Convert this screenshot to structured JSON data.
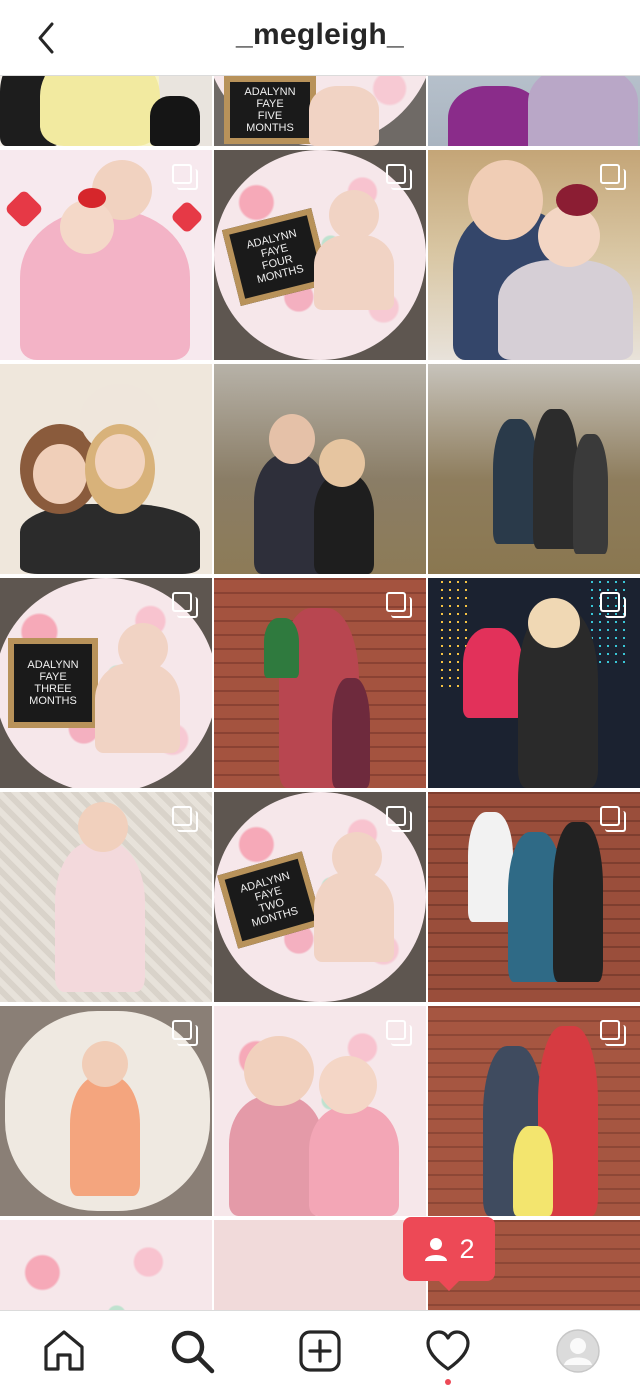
{
  "header": {
    "username": "_megleigh_",
    "back_icon": "chevron-left-icon"
  },
  "grid": {
    "signs": {
      "five_months": "ADALYNN\nFAYE\nFIVE\nMONTHS",
      "four_months": "ADALYNN\nFAYE\nFOUR\nMONTHS",
      "three_months": "ADALYNN\nFAYE\nTHREE\nMONTHS",
      "two_months": "ADALYNN\nFAYE\nTWO MONTHS"
    }
  },
  "notification": {
    "icon": "person-icon",
    "count": "2"
  },
  "tabbar": {
    "items": [
      "home-icon",
      "search-icon",
      "add-post-icon",
      "activity-heart-icon",
      "profile-avatar-icon"
    ]
  },
  "colors": {
    "accent_red": "#ed4956",
    "divider": "#dbdbdb",
    "text": "#262626"
  }
}
